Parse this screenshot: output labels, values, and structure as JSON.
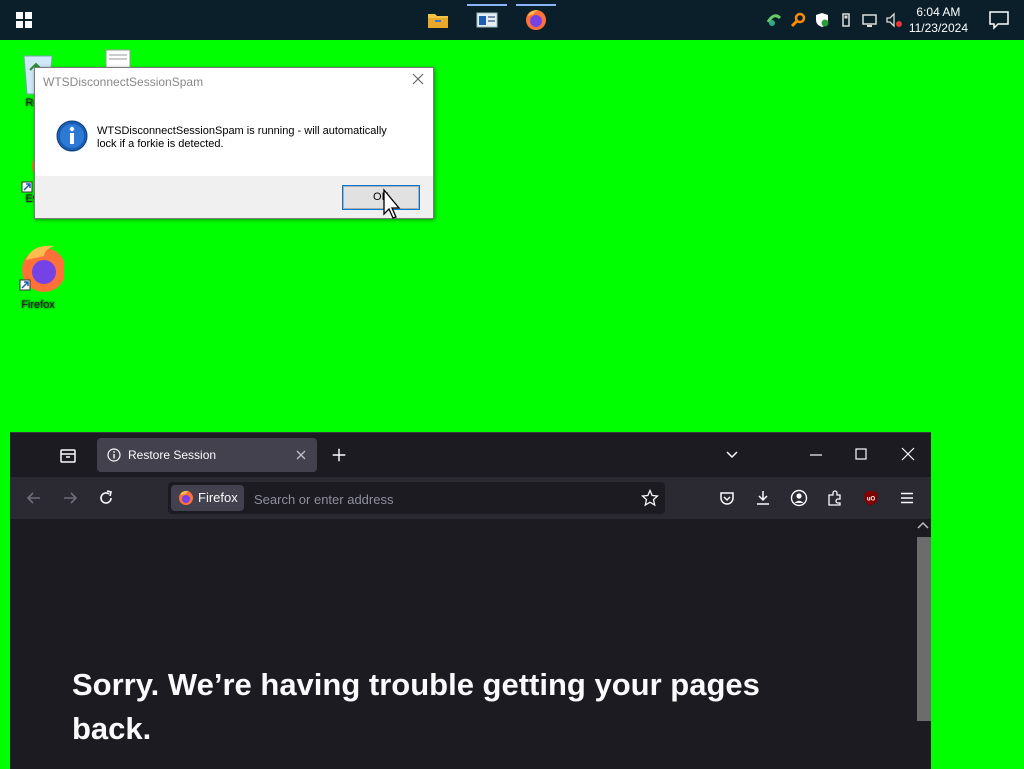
{
  "taskbar": {
    "clock_time": "6:04 AM",
    "clock_date": "11/23/2024",
    "apps": [
      {
        "name": "file-explorer"
      },
      {
        "name": "app-window"
      },
      {
        "name": "firefox"
      }
    ]
  },
  "desktop": {
    "icons": [
      {
        "label": "Recy"
      },
      {
        "label": "Even"
      },
      {
        "label": "Firefox"
      }
    ]
  },
  "msgbox": {
    "title": "WTSDisconnectSessionSpam",
    "message_line1": "WTSDisconnectSessionSpam is running - will automatically",
    "message_line2": "lock if a forkie is detected.",
    "ok_label": "OK"
  },
  "firefox": {
    "tab_title": "Restore Session",
    "identity_label": "Firefox",
    "url_placeholder": "Search or enter address",
    "heading": "Sorry. We’re having trouble getting your pages back."
  },
  "colors": {
    "desktop_bg": "#00ff00",
    "taskbar_bg": "#0b1f2a",
    "firefox_bg": "#1c1b22",
    "firefox_toolbar": "#2b2a33"
  }
}
